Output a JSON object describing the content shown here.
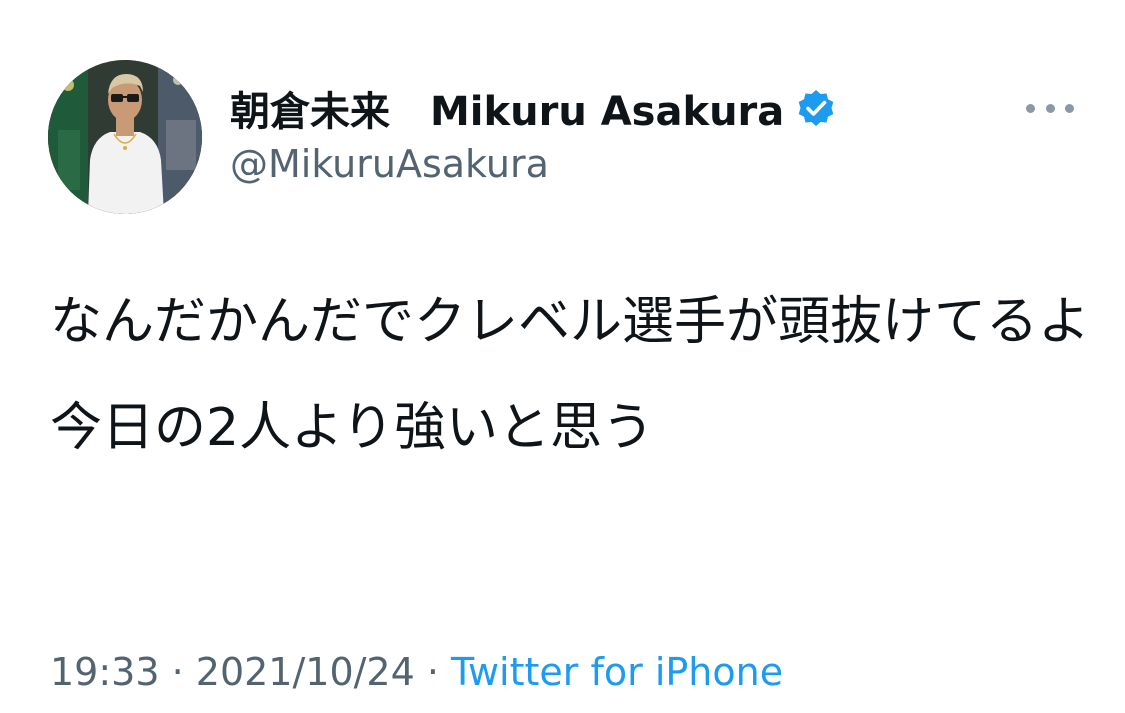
{
  "tweet": {
    "author": {
      "display_name": "朝倉未来　Mikuru Asakura",
      "handle": "@MikuruAsakura",
      "verified": true,
      "avatar_icon": "avatar-photo"
    },
    "more_icon": "more-horizontal-icon",
    "text_paragraphs": [
      "なんだかんだでクレベル選手が頭抜けてるよ",
      "今日の2人より強いと思う"
    ],
    "time": "19:33",
    "separator": " · ",
    "date": "2021/10/24",
    "source": "Twitter for iPhone"
  },
  "colors": {
    "accent": "#1d9bf0",
    "text": "#0f1419",
    "secondary": "#536471"
  }
}
